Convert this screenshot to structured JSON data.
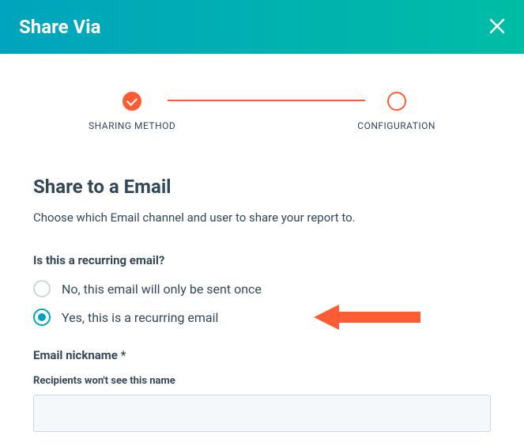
{
  "header": {
    "title": "Share Via"
  },
  "stepper": {
    "step1": "SHARING METHOD",
    "step2": "CONFIGURATION"
  },
  "section": {
    "title": "Share to a Email",
    "description": "Choose which Email channel and user to share your report to."
  },
  "recurring": {
    "question": "Is this a recurring email?",
    "option_no": "No, this email will only be sent once",
    "option_yes": "Yes, this is a recurring email"
  },
  "nickname": {
    "label": "Email nickname *",
    "hint": "Recipients won't see this name",
    "value": ""
  }
}
